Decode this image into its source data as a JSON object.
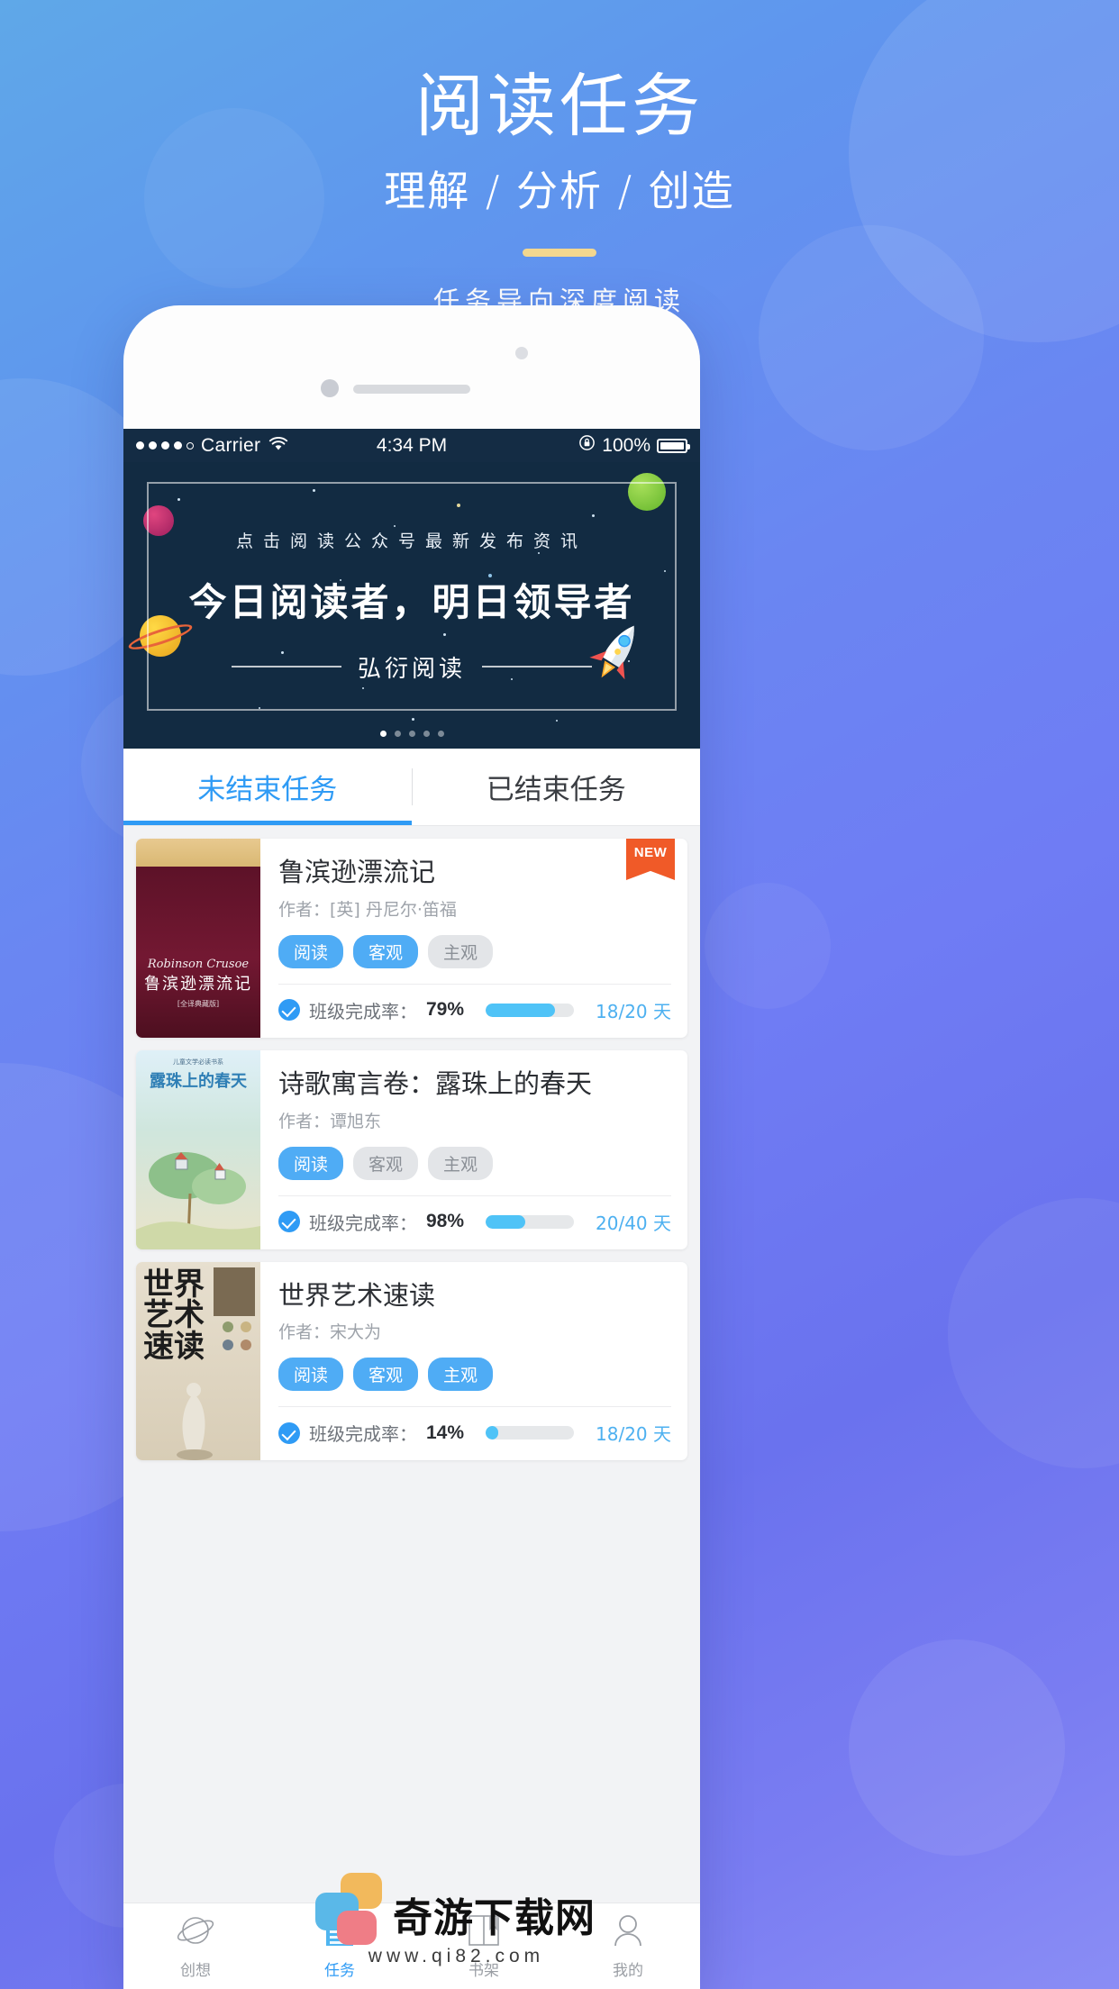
{
  "hero": {
    "title": "阅读任务",
    "subtitle": "理解 / 分析 / 创造",
    "tagline": "任务导向深度阅读"
  },
  "statusbar": {
    "carrier": "Carrier",
    "time": "4:34 PM",
    "battery": "100%",
    "wifi_icon": "wifi-icon",
    "lock_icon": "rotation-lock-icon",
    "battery_icon": "battery-icon"
  },
  "banner": {
    "kicker": "点击阅读公众号最新发布资讯",
    "headline": "今日阅读者，明日领导者",
    "signature": "弘衍阅读",
    "dot_count": 5,
    "active_dot": 0,
    "bg_color": "#122b42"
  },
  "tabs": {
    "items": [
      {
        "label": "未结束任务",
        "active": true
      },
      {
        "label": "已结束任务",
        "active": false
      }
    ],
    "accent_color": "#2f9bf5"
  },
  "books": [
    {
      "title": "鲁滨逊漂流记",
      "author": "作者：[英] 丹尼尔·笛福",
      "tags": [
        {
          "label": "阅读",
          "style": "blue"
        },
        {
          "label": "客观",
          "style": "blue"
        },
        {
          "label": "主观",
          "style": "grey"
        }
      ],
      "progress_label": "班级完成率：",
      "progress_value": "79%",
      "progress_pct": 79,
      "days": "18/20 天",
      "badge": "NEW",
      "cover_title": "鲁滨逊漂流记",
      "cover_en": "Robinson Crusoe",
      "cover_small": "[全译典藏版]"
    },
    {
      "title": "诗歌寓言卷：露珠上的春天",
      "author": "作者：谭旭东",
      "tags": [
        {
          "label": "阅读",
          "style": "blue"
        },
        {
          "label": "客观",
          "style": "grey"
        },
        {
          "label": "主观",
          "style": "grey"
        }
      ],
      "progress_label": "班级完成率：",
      "progress_value": "98%",
      "progress_pct": 45,
      "days": "20/40 天",
      "badge": "",
      "cover_title": "露珠上的春天",
      "cover_en": "",
      "cover_small": "儿童文学必读书系"
    },
    {
      "title": "世界艺术速读",
      "author": "作者：宋大为",
      "tags": [
        {
          "label": "阅读",
          "style": "blue"
        },
        {
          "label": "客观",
          "style": "blue"
        },
        {
          "label": "主观",
          "style": "blue"
        }
      ],
      "progress_label": "班级完成率：",
      "progress_value": "14%",
      "progress_pct": 14,
      "days": "18/20 天",
      "badge": "",
      "cover_title": "世界\n艺术\n速读",
      "cover_en": "",
      "cover_small": ""
    }
  ],
  "tabbar": {
    "items": [
      {
        "label": "创想",
        "icon": "planet-icon",
        "active": false
      },
      {
        "label": "任务",
        "icon": "document-icon",
        "active": true
      },
      {
        "label": "书架",
        "icon": "book-icon",
        "active": false
      },
      {
        "label": "我的",
        "icon": "user-icon",
        "active": false
      }
    ]
  },
  "watermark": {
    "text": "奇游下载网",
    "url": "www.qi82.com"
  }
}
